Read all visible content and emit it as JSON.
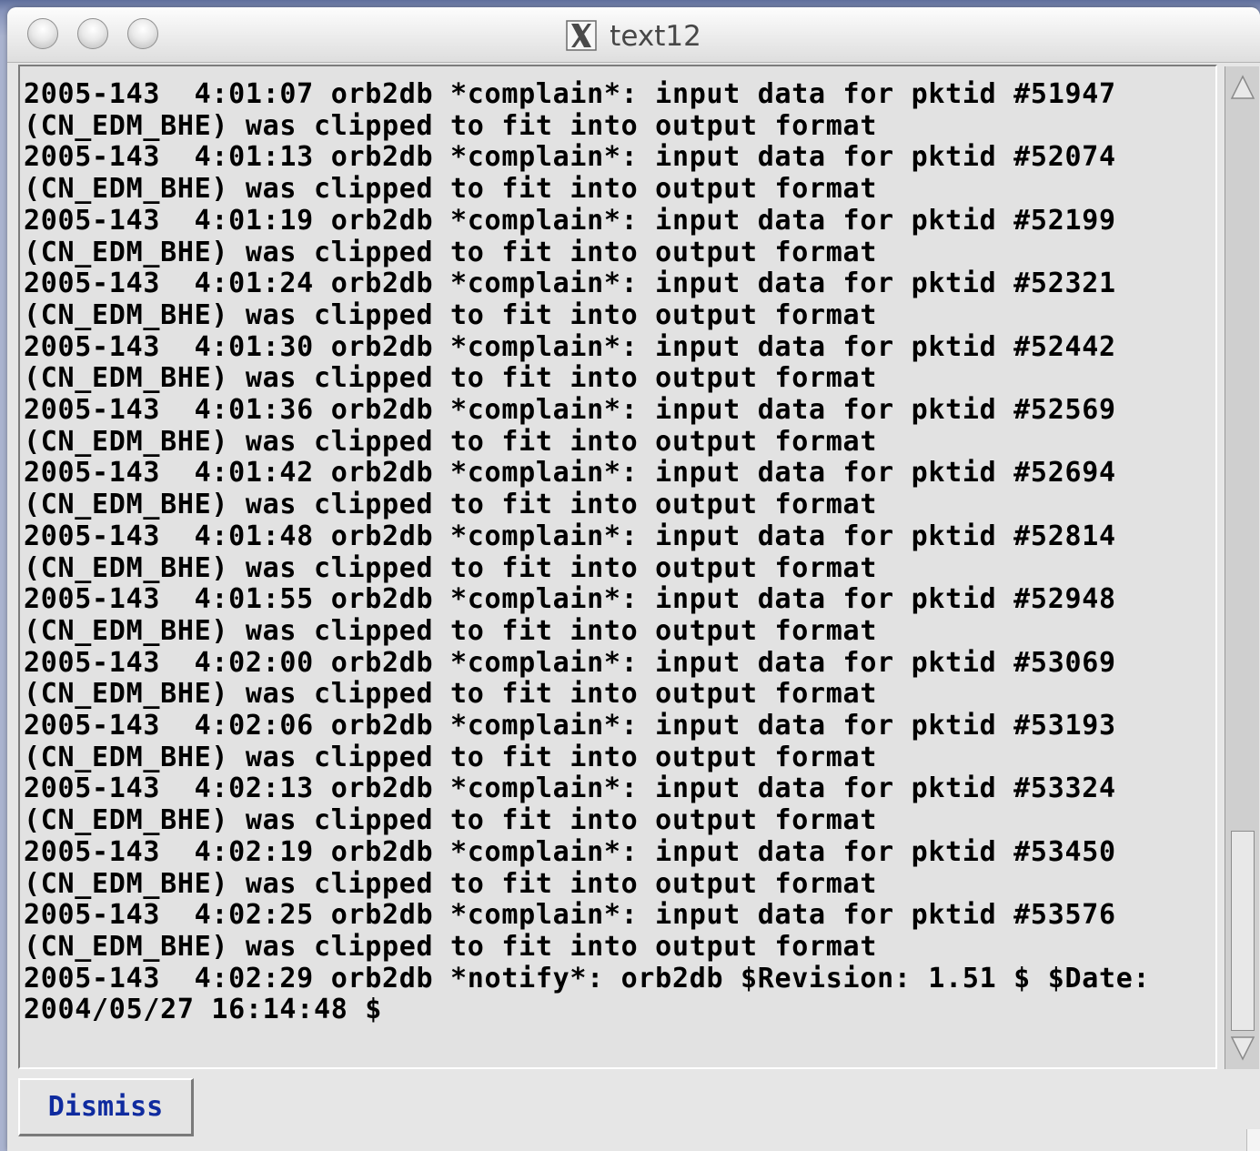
{
  "window": {
    "title": "text12"
  },
  "log": {
    "lines": [
      "2005-143  4:01:07 orb2db *complain*: input data for pktid #51947",
      "(CN_EDM_BHE) was clipped to fit into output format",
      "2005-143  4:01:13 orb2db *complain*: input data for pktid #52074",
      "(CN_EDM_BHE) was clipped to fit into output format",
      "2005-143  4:01:19 orb2db *complain*: input data for pktid #52199",
      "(CN_EDM_BHE) was clipped to fit into output format",
      "2005-143  4:01:24 orb2db *complain*: input data for pktid #52321",
      "(CN_EDM_BHE) was clipped to fit into output format",
      "2005-143  4:01:30 orb2db *complain*: input data for pktid #52442",
      "(CN_EDM_BHE) was clipped to fit into output format",
      "2005-143  4:01:36 orb2db *complain*: input data for pktid #52569",
      "(CN_EDM_BHE) was clipped to fit into output format",
      "2005-143  4:01:42 orb2db *complain*: input data for pktid #52694",
      "(CN_EDM_BHE) was clipped to fit into output format",
      "2005-143  4:01:48 orb2db *complain*: input data for pktid #52814",
      "(CN_EDM_BHE) was clipped to fit into output format",
      "2005-143  4:01:55 orb2db *complain*: input data for pktid #52948",
      "(CN_EDM_BHE) was clipped to fit into output format",
      "2005-143  4:02:00 orb2db *complain*: input data for pktid #53069",
      "(CN_EDM_BHE) was clipped to fit into output format",
      "2005-143  4:02:06 orb2db *complain*: input data for pktid #53193",
      "(CN_EDM_BHE) was clipped to fit into output format",
      "2005-143  4:02:13 orb2db *complain*: input data for pktid #53324",
      "(CN_EDM_BHE) was clipped to fit into output format",
      "2005-143  4:02:19 orb2db *complain*: input data for pktid #53450",
      "(CN_EDM_BHE) was clipped to fit into output format",
      "2005-143  4:02:25 orb2db *complain*: input data for pktid #53576",
      "(CN_EDM_BHE) was clipped to fit into output format",
      "2005-143  4:02:29 orb2db *notify*: orb2db $Revision: 1.51 $ $Date:",
      "2004/05/27 16:14:48 $"
    ]
  },
  "buttons": {
    "dismiss_label": "Dismiss"
  },
  "icons": {
    "app_icon": "x11-icon",
    "close": "close-icon",
    "minimize": "minimize-icon",
    "zoom": "zoom-icon",
    "scroll_up": "arrow-up-icon",
    "scroll_down": "arrow-down-icon"
  },
  "colors": {
    "button_text": "#0f2b9f",
    "text_bg": "#e2e2e2",
    "window_bg": "#e6e6e6"
  }
}
